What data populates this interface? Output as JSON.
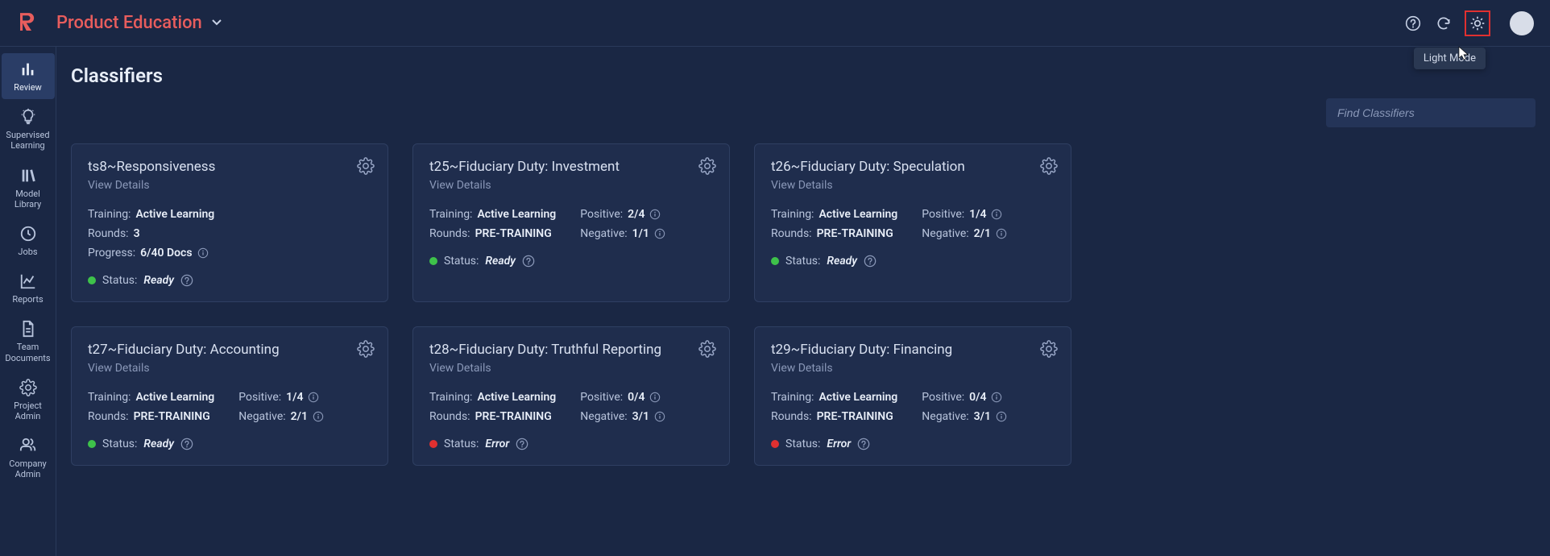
{
  "header": {
    "app_title": "Product Education"
  },
  "tooltip": "Light Mode",
  "sidebar": {
    "items": [
      {
        "label": "Review"
      },
      {
        "label": "Supervised Learning"
      },
      {
        "label": "Model Library"
      },
      {
        "label": "Jobs"
      },
      {
        "label": "Reports"
      },
      {
        "label": "Team Documents"
      },
      {
        "label": "Project Admin"
      },
      {
        "label": "Company Admin"
      }
    ]
  },
  "page": {
    "title": "Classifiers",
    "search_placeholder": "Find Classifiers"
  },
  "labels": {
    "view_details": "View Details",
    "training": "Training: ",
    "rounds": "Rounds: ",
    "progress": "Progress: ",
    "positive": "Positive: ",
    "negative": "Negative: ",
    "status": "Status: "
  },
  "cards": [
    {
      "title": "ts8~Responsiveness",
      "training": "Active Learning",
      "rounds": "3",
      "progress": "6/40 Docs",
      "status": "Ready",
      "status_color": "green"
    },
    {
      "title": "t25~Fiduciary Duty: Investment",
      "training": "Active Learning",
      "rounds": "PRE-TRAINING",
      "positive": "2/4",
      "negative": "1/1",
      "status": "Ready",
      "status_color": "green"
    },
    {
      "title": "t26~Fiduciary Duty: Speculation",
      "training": "Active Learning",
      "rounds": "PRE-TRAINING",
      "positive": "1/4",
      "negative": "2/1",
      "status": "Ready",
      "status_color": "green"
    },
    {
      "title": "t27~Fiduciary Duty: Accounting",
      "training": "Active Learning",
      "rounds": "PRE-TRAINING",
      "positive": "1/4",
      "negative": "2/1",
      "status": "Ready",
      "status_color": "green"
    },
    {
      "title": "t28~Fiduciary Duty: Truthful Reporting",
      "training": "Active Learning",
      "rounds": "PRE-TRAINING",
      "positive": "0/4",
      "negative": "3/1",
      "status": "Error",
      "status_color": "red"
    },
    {
      "title": "t29~Fiduciary Duty: Financing",
      "training": "Active Learning",
      "rounds": "PRE-TRAINING",
      "positive": "0/4",
      "negative": "3/1",
      "status": "Error",
      "status_color": "red"
    }
  ]
}
